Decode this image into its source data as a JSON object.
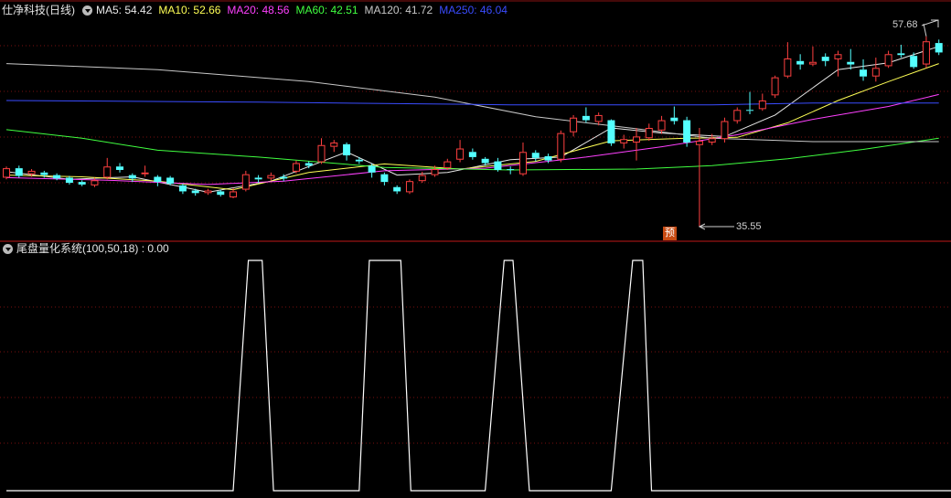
{
  "header": {
    "stock_title": "仕净科技(日线)",
    "ma5": "MA5: 54.42",
    "ma10": "MA10: 52.66",
    "ma20": "MA20: 48.56",
    "ma60": "MA60: 42.51",
    "ma120": "MA120: 41.72",
    "ma250": "MA250: 46.04"
  },
  "indicator": {
    "title": "尾盘量化系统(100,50,18) : 0.00"
  },
  "annotations": {
    "high": "57.68",
    "low": "35.55",
    "forecast_badge": "预"
  },
  "colors": {
    "up": "#ff4040",
    "down": "#54ffff",
    "ma5": "#e8e8e8",
    "ma10": "#ffff55",
    "ma20": "#ff40ff",
    "ma60": "#40ff40",
    "ma120": "#c8c8c8",
    "ma250": "#3a4cff",
    "indicator": "#ffffff",
    "grid": "#7a1010"
  },
  "chart_data": [
    {
      "type": "candlestick",
      "title": "仕净科技(日线)",
      "price_range": [
        34,
        60
      ],
      "candles": [
        [
          41.2,
          42.3,
          42.5,
          41.0
        ],
        [
          42.3,
          41.4,
          42.6,
          41.2
        ],
        [
          41.6,
          42.0,
          42.2,
          41.3
        ],
        [
          41.8,
          41.5,
          42.0,
          41.2
        ],
        [
          41.5,
          41.1,
          41.7,
          40.9
        ],
        [
          41.2,
          40.6,
          41.4,
          40.4
        ],
        [
          40.7,
          40.4,
          40.9,
          40.2
        ],
        [
          40.3,
          40.9,
          41.2,
          40.1
        ],
        [
          41.2,
          42.5,
          43.5,
          41.0
        ],
        [
          42.5,
          42.1,
          42.9,
          41.8
        ],
        [
          41.5,
          41.1,
          41.7,
          40.7
        ],
        [
          41.6,
          41.8,
          42.6,
          41.3
        ],
        [
          41.3,
          40.7,
          41.5,
          40.2
        ],
        [
          41.2,
          40.5,
          41.4,
          40.3
        ],
        [
          40.3,
          39.6,
          40.5,
          39.3
        ],
        [
          39.7,
          39.4,
          39.9,
          39.1
        ],
        [
          39.4,
          39.7,
          39.9,
          39.2
        ],
        [
          39.6,
          39.2,
          39.8,
          39.0
        ],
        [
          38.9,
          39.6,
          40.0,
          38.8
        ],
        [
          39.8,
          41.6,
          42.0,
          39.6
        ],
        [
          41.2,
          41.0,
          41.5,
          40.6
        ],
        [
          41.1,
          41.5,
          41.8,
          40.9
        ],
        [
          41.3,
          41.1,
          41.6,
          40.8
        ],
        [
          41.9,
          42.9,
          43.2,
          41.7
        ],
        [
          42.9,
          42.6,
          43.1,
          42.3
        ],
        [
          43.0,
          45.0,
          45.8,
          42.8
        ],
        [
          44.8,
          45.3,
          45.6,
          44.2
        ],
        [
          45.1,
          43.8,
          45.3,
          43.2
        ],
        [
          43.3,
          43.1,
          43.6,
          42.8
        ],
        [
          42.6,
          41.8,
          42.8,
          41.2
        ],
        [
          41.6,
          40.7,
          41.8,
          40.3
        ],
        [
          40.1,
          39.6,
          40.3,
          39.3
        ],
        [
          39.5,
          40.8,
          41.0,
          39.3
        ],
        [
          40.8,
          41.5,
          41.9,
          40.6
        ],
        [
          41.5,
          42.2,
          42.6,
          41.3
        ],
        [
          42.3,
          43.1,
          43.4,
          42.1
        ],
        [
          43.3,
          44.6,
          45.6,
          43.0
        ],
        [
          44.2,
          43.6,
          44.6,
          43.3
        ],
        [
          43.4,
          42.9,
          43.6,
          42.6
        ],
        [
          43.1,
          42.1,
          43.5,
          41.9
        ],
        [
          42.2,
          42.1,
          42.5,
          41.6
        ],
        [
          41.6,
          44.2,
          45.3,
          41.4
        ],
        [
          44.1,
          43.5,
          44.4,
          43.1
        ],
        [
          43.7,
          43.2,
          44.0,
          42.9
        ],
        [
          43.3,
          46.4,
          46.7,
          43.0
        ],
        [
          46.5,
          48.2,
          48.5,
          46.0
        ],
        [
          48.4,
          47.9,
          49.4,
          47.6
        ],
        [
          47.7,
          48.5,
          48.8,
          47.3
        ],
        [
          47.9,
          45.2,
          48.0,
          44.9
        ],
        [
          45.2,
          45.7,
          46.2,
          44.6
        ],
        [
          45.3,
          46.0,
          47.0,
          43.2
        ],
        [
          45.8,
          47.0,
          47.5,
          45.5
        ],
        [
          46.7,
          47.9,
          48.4,
          46.3
        ],
        [
          48.2,
          47.8,
          49.5,
          47.4
        ],
        [
          47.9,
          45.3,
          48.3,
          44.8
        ],
        [
          45.0,
          45.5,
          47.0,
          35.55
        ],
        [
          45.3,
          45.8,
          46.3,
          45.0
        ],
        [
          45.7,
          47.8,
          48.2,
          45.3
        ],
        [
          47.8,
          49.1,
          49.4,
          47.5
        ],
        [
          49.1,
          49.0,
          51.2,
          48.6
        ],
        [
          49.2,
          50.2,
          51.0,
          49.0
        ],
        [
          50.8,
          52.9,
          53.1,
          50.5
        ],
        [
          53.0,
          55.1,
          57.0,
          52.8
        ],
        [
          54.8,
          54.4,
          55.6,
          53.8
        ],
        [
          54.4,
          54.7,
          56.5,
          54.2
        ],
        [
          55.3,
          54.8,
          55.7,
          54.2
        ],
        [
          55.0,
          55.6,
          56.0,
          53.0
        ],
        [
          54.7,
          54.4,
          56.2,
          53.8
        ],
        [
          53.8,
          53.0,
          55.0,
          52.5
        ],
        [
          53.0,
          54.0,
          55.2,
          52.4
        ],
        [
          54.2,
          55.6,
          56.0,
          54.0
        ],
        [
          55.7,
          55.5,
          56.7,
          55.2
        ],
        [
          55.4,
          54.1,
          55.8,
          53.9
        ],
        [
          54.4,
          57.1,
          57.68,
          54.0
        ],
        [
          56.9,
          55.8,
          57.3,
          55.5
        ]
      ],
      "moving_averages": {
        "MA5": [
          [
            0,
            41.9
          ],
          [
            5,
            41.0
          ],
          [
            10,
            41.3
          ],
          [
            16,
            39.5
          ],
          [
            21,
            40.8
          ],
          [
            27,
            44.2
          ],
          [
            31,
            41.5
          ],
          [
            35,
            41.8
          ],
          [
            40,
            43.3
          ],
          [
            44,
            43.6
          ],
          [
            48,
            47.0
          ],
          [
            52,
            46.4
          ],
          [
            57,
            46.0
          ],
          [
            61,
            48.5
          ],
          [
            66,
            53.8
          ],
          [
            70,
            54.6
          ],
          [
            74,
            56.5
          ]
        ],
        "MA10": [
          [
            0,
            41.5
          ],
          [
            6,
            41.3
          ],
          [
            12,
            40.8
          ],
          [
            18,
            39.8
          ],
          [
            24,
            41.8
          ],
          [
            30,
            42.8
          ],
          [
            36,
            42.2
          ],
          [
            42,
            43.1
          ],
          [
            48,
            45.5
          ],
          [
            54,
            45.8
          ],
          [
            58,
            45.9
          ],
          [
            62,
            47.6
          ],
          [
            66,
            50.2
          ],
          [
            70,
            52.4
          ],
          [
            74,
            54.5
          ]
        ],
        "MA20": [
          [
            0,
            41.2
          ],
          [
            8,
            40.9
          ],
          [
            16,
            40.4
          ],
          [
            22,
            40.8
          ],
          [
            30,
            42.0
          ],
          [
            38,
            42.3
          ],
          [
            46,
            43.6
          ],
          [
            52,
            44.8
          ],
          [
            58,
            46.2
          ],
          [
            64,
            48.0
          ],
          [
            70,
            49.5
          ],
          [
            74,
            50.9
          ]
        ],
        "MA60": [
          [
            0,
            46.8
          ],
          [
            6,
            45.8
          ],
          [
            12,
            44.4
          ],
          [
            20,
            43.6
          ],
          [
            30,
            42.4
          ],
          [
            40,
            42.1
          ],
          [
            50,
            42.2
          ],
          [
            56,
            42.6
          ],
          [
            62,
            43.4
          ],
          [
            68,
            44.5
          ],
          [
            74,
            45.8
          ]
        ],
        "MA120": [
          [
            0,
            54.5
          ],
          [
            12,
            53.8
          ],
          [
            24,
            52.4
          ],
          [
            34,
            50.6
          ],
          [
            42,
            48.3
          ],
          [
            50,
            46.9
          ],
          [
            56,
            45.8
          ],
          [
            64,
            45.4
          ],
          [
            74,
            45.4
          ]
        ],
        "MA250": [
          [
            0,
            50.2
          ],
          [
            20,
            50.0
          ],
          [
            40,
            49.7
          ],
          [
            56,
            49.7
          ],
          [
            64,
            49.9
          ],
          [
            74,
            49.9
          ]
        ]
      }
    },
    {
      "type": "line",
      "title": "尾盘量化系统(100,50,18)",
      "ylim": [
        0,
        100
      ],
      "x": [
        0,
        18,
        19.2,
        20.3,
        21.2,
        28,
        28.8,
        31.3,
        32.1,
        38,
        39.5,
        40.2,
        41.5,
        48,
        49.7,
        50.5,
        51.2,
        75
      ],
      "values": [
        0,
        0,
        100,
        100,
        0,
        0,
        100,
        100,
        0,
        0,
        100,
        100,
        0,
        0,
        100,
        100,
        0,
        0
      ]
    }
  ]
}
